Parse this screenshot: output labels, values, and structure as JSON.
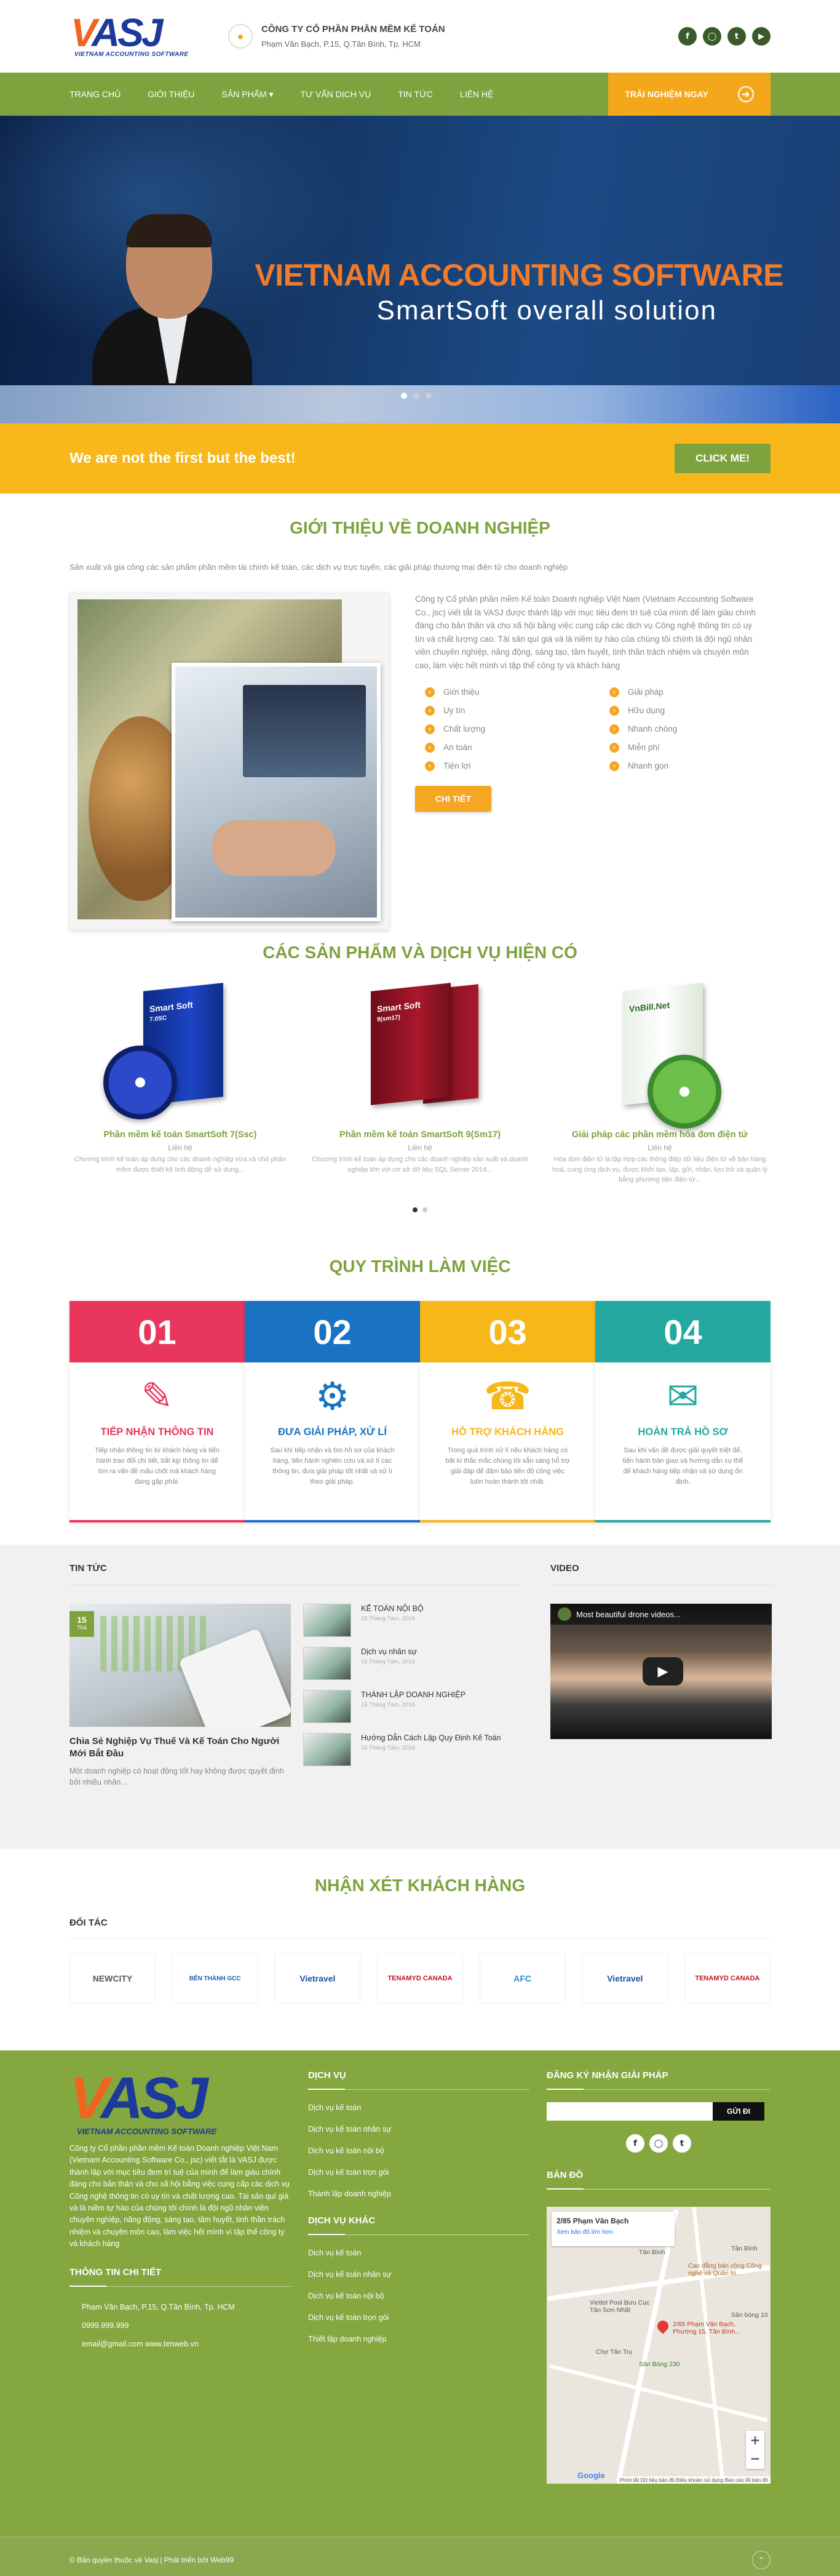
{
  "header": {
    "logo_text_v": "V",
    "logo_text_asj": "ASJ",
    "logo_sub": "VIETNAM ACCOUNTING SOFTWARE",
    "company_name": "CÔNG TY CỔ PHẦN PHẦN MỀM KẾ TOÁN",
    "address": "Phạm Văn Bạch, P.15, Q.Tân Bình, Tp. HCM",
    "socials": [
      "facebook-icon",
      "instagram-icon",
      "twitter-icon",
      "youtube-icon"
    ]
  },
  "nav": {
    "items": [
      "TRANG CHỦ",
      "GIỚI THIỆU",
      "SẢN PHẨM ▾",
      "TƯ VẤN DỊCH VỤ",
      "TIN TỨC",
      "LIÊN HỆ"
    ],
    "cta": "TRẢI NGHIỆM NGAY"
  },
  "hero": {
    "title": "VIETNAM ACCOUNTING SOFTWARE",
    "subtitle": "SmartSoft overall solution",
    "slides_total": 3,
    "slide_active": 1
  },
  "strip": {
    "text": "We are not the first but the best!",
    "button": "CLICK ME!"
  },
  "about": {
    "title": "GIỚI THIỆU VỀ DOANH NGHIỆP",
    "lead": "Sản xuất và gia công các sản phẩm phần mềm tài chính kế toán, các dịch vụ trực tuyến, các giải pháp thương mại điện tử cho doanh nghiệp",
    "body": "Công ty Cổ phần phần mềm Kế toán Doanh nghiệp Việt Nam (Vietnam Accounting Software Co., jsc) viết tắt là VASJ được thành lập với mục tiêu đem trí tuệ của mình để làm giàu chính đáng cho bản thân và cho xã hội bằng việc cung cấp các dịch vụ Công nghệ thông tin có uy tín và chất lượng cao. Tài sản quí giá và là niềm tự hào của chúng tôi chính là đội ngũ nhân viên chuyên nghiệp, năng động, sáng tạo, tâm huyết, tinh thần trách nhiệm và chuyên môn cao, làm việc hết mình vì tập thể công ty và khách hàng",
    "features": [
      "Giới thiệu",
      "Giải pháp",
      "Uy tín",
      "Hữu dụng",
      "Chất lượng",
      "Nhanh chóng",
      "An toàn",
      "Miễn phí",
      "Tiện lợi",
      "Nhanh gọn"
    ],
    "button": "CHI TIẾT"
  },
  "products": {
    "title": "CÁC SẢN PHẨM VÀ DỊCH VỤ HIỆN CÓ",
    "items": [
      {
        "name": "Phần mềm kế toán SmartSoft 7(Ssc)",
        "price": "Liên hệ",
        "desc": "Chương trình kế toán áp dụng cho các doanh nghiệp vừa và nhỏ phần mềm được thiết kế linh động dễ sử dụng...",
        "box": "Smart Soft",
        "box2": "7.0SC"
      },
      {
        "name": "Phần mềm kế toán SmartSoft 9(Sm17)",
        "price": "Liên hệ",
        "desc": "Chương trình kế toán áp dụng cho các doanh nghiệp sản xuất và doanh nghiệp lớn với cơ sở dữ liệu SQL Server 2014...",
        "box": "Smart Soft",
        "box2": "9(sm17)"
      },
      {
        "name": "Giải pháp các phần mềm hóa đơn điện tử",
        "price": "Liên hệ",
        "desc": "Hóa đơn điện tử là tập hợp các thông điệp dữ liệu điện tử về bán hàng hoá, cung ứng dịch vụ, được khởi tạo, lập, gửi, nhận, lưu trữ và quản lý bằng phương tiện điện tử...",
        "box": "VnBill.Net",
        "box2": ""
      }
    ]
  },
  "process": {
    "title": "QUY TRÌNH LÀM VIỆC",
    "steps": [
      {
        "num": "01",
        "name": "TIẾP NHẬN THÔNG TIN",
        "desc": "Tiếp nhận thông tin từ khách hàng và tiến hành trao đổi chi tiết, bắt kịp thông tin để tìm ra vấn đề mấu chốt mà khách hàng đang gặp phải.",
        "color": "#e8365d",
        "icon": "edit-note-icon"
      },
      {
        "num": "02",
        "name": "ĐƯA GIẢI PHÁP, XỬ LÍ",
        "desc": "Sau khi tiếp nhận và tìm hồ sơ của khách hàng, tiến hành nghiên cứu và xử lí các thông tin, đưa giải pháp tốt nhất và xử lí theo giải pháp.",
        "color": "#1a73c2",
        "icon": "settings-users-icon"
      },
      {
        "num": "03",
        "name": "HỖ TRỢ KHÁCH HÀNG",
        "desc": "Trong quá trình xử lí nếu khách hàng có bất kì thắc mắc chúng tôi sẵn sàng hỗ trợ giải đáp để đảm bảo tiến độ công việc luôn hoàn thành tốt nhất.",
        "color": "#f7b718",
        "icon": "support-agent-icon"
      },
      {
        "num": "04",
        "name": "HOÀN TRẢ HỒ SƠ",
        "desc": "Sau khi vấn đề được giải quyết triệt để, tiến hành bàn giao và hướng dẫn cụ thể để khách hàng tiếp nhận và sử dụng ổn định.",
        "color": "#25a8a0",
        "icon": "mail-open-icon"
      }
    ]
  },
  "news": {
    "title": "TIN TỨC",
    "feature": {
      "day": "15",
      "month": "Th4",
      "title": "Chia Sẻ Nghiệp Vụ Thuế Và Kế Toán Cho Người Mới Bắt Đầu",
      "desc": "Một doanh nghiệp có hoạt động tốt hay không được quyết định bởi nhiều nhân..."
    },
    "list": [
      {
        "title": "KẾ TOÁN NỘI BỘ",
        "date": "15 Tháng Tám, 2016"
      },
      {
        "title": "Dịch vụ nhân sự",
        "date": "15 Tháng Tám, 2016"
      },
      {
        "title": "THÀNH LẬP DOANH NGHIỆP",
        "date": "15 Tháng Tám, 2016"
      },
      {
        "title": "Hướng Dẫn Cách Lập Quy Định Kế Toán",
        "date": "15 Tháng Tám, 2016"
      }
    ],
    "video_title": "VIDEO",
    "video_caption": "Most beautiful drone videos..."
  },
  "testimonials": {
    "title": "NHẬN XÉT KHÁCH HÀNG"
  },
  "partners": {
    "title": "ĐỐI TÁC",
    "logos": [
      "NEWCITY",
      "BẾN THÀNH GCC",
      "Vietravel",
      "TENAMYD CANADA",
      "AFC",
      "Vietravel",
      "TENAMYD CANADA"
    ]
  },
  "footer": {
    "about": "Công ty Cổ phần phần mềm Kế toán Doanh nghiệp Việt Nam (Vietnam Accounting Software Co., jsc) viết tắt là VASJ được thành lập với mục tiêu đem trí tuệ của mình để làm giàu chính đáng cho bản thân và cho xã hội bằng việc cung cấp các dịch vụ Công nghệ thông tin có uy tín và chất lượng cao. Tài sản quí giá và là niềm tự hào của chúng tôi chính là đội ngũ nhân viên chuyên nghiệp, năng động, sáng tạo, tâm huyết, tinh thần trách nhiệm và chuyên môn cao, làm việc hết mình vì tập thể công ty và khách hàng",
    "contact_title": "THÔNG TIN CHI TIẾT",
    "contact_address": "Phạm Văn Bạch, P.15, Q.Tân Bình, Tp. HCM",
    "contact_phone": "0999.999.999",
    "contact_email": "email@gmail.com   www.tenweb.vn",
    "services_title": "DỊCH VỤ",
    "services": [
      "Dịch vụ kế toán",
      "Dịch vụ kế toán nhân sự",
      "Dịch vụ kế toán nội bộ",
      "Dịch vụ kế toán trọn gói",
      "Thành lập doanh nghiệp"
    ],
    "other_title": "DỊCH VỤ KHÁC",
    "other": [
      "Dịch vụ kế toán",
      "Dịch vụ kế toán nhân sự",
      "Dịch vụ kế toán nội bộ",
      "Dịch vụ kế toán trọn gói",
      "Thiết lập doanh nghiệp"
    ],
    "subscribe_title": "ĐĂNG KÝ NHẬN GIẢI PHÁP",
    "subscribe_btn": "GỬI ĐI",
    "map_title": "BẢN ĐỒ",
    "map_card_title": "2/85 Phạm Văn Bạch",
    "map_card_link": "Xem bản đồ lớn hơn",
    "map_labels": [
      "Tân Bình",
      "Cao đẳng bán công Công nghệ và Quản trị...",
      "Tân Bình",
      "Viettel Post Bưu Cục Tân Sơn Nhất",
      "Sân bóng 10",
      "2/85 Phạm Văn Bạch, Phường 15, Tân Bình...",
      "Chợ Tân Trụ",
      "Sân Bóng 230"
    ],
    "map_terms": "Phím tắt   Dữ liệu bản đồ   Điều khoản sử dụng   Báo cáo lỗi bản đồ",
    "copyright": "© Bản quyền thuộc về Vasj | Phát triển bởi Web99"
  }
}
